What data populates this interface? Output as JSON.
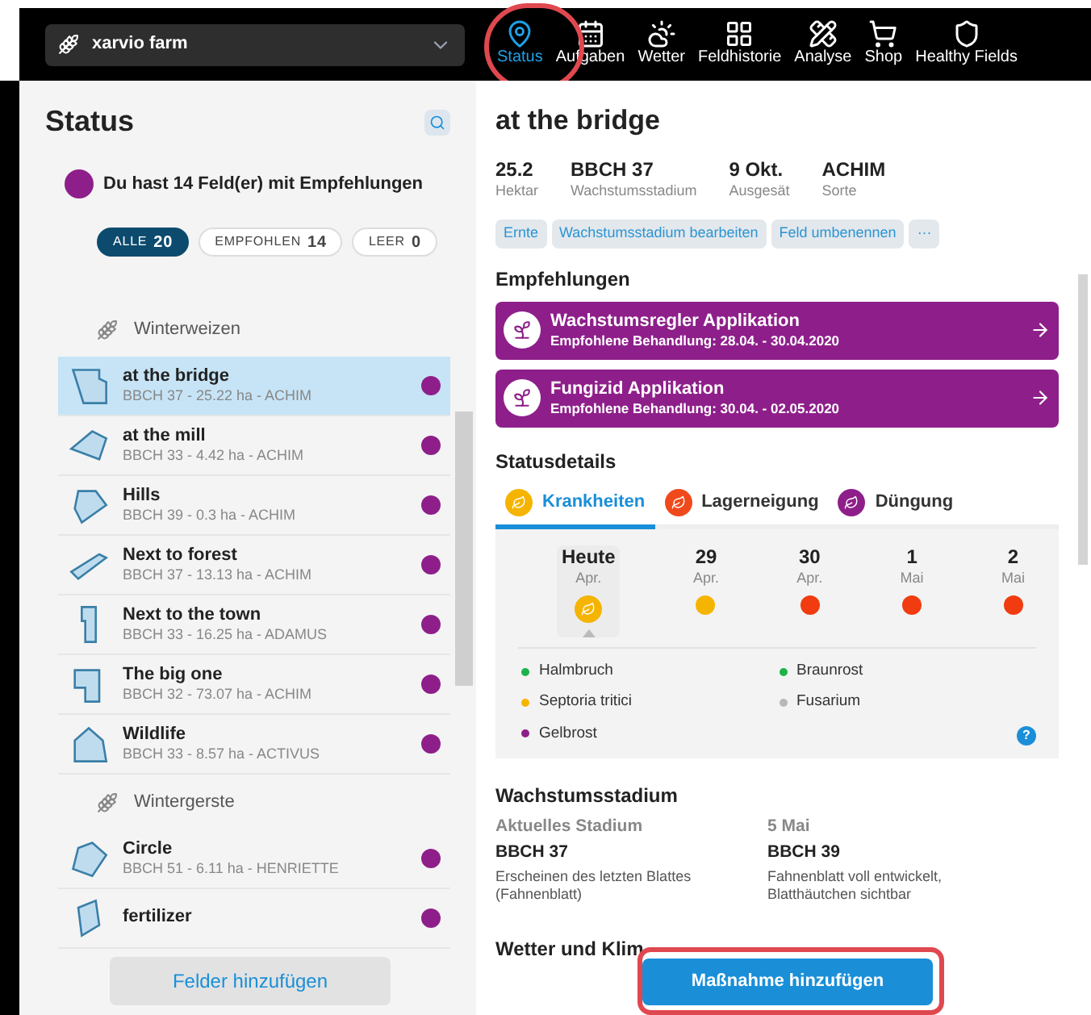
{
  "farm_selector": {
    "label": "xarvio farm"
  },
  "nav": [
    {
      "label": "Status",
      "selected": true
    },
    {
      "label": "Aufgaben",
      "selected": false
    },
    {
      "label": "Wetter",
      "selected": false
    },
    {
      "label": "Feldhistorie",
      "selected": false
    },
    {
      "label": "Analyse",
      "selected": false
    },
    {
      "label": "Shop",
      "selected": false
    },
    {
      "label": "Healthy Fields",
      "selected": false
    }
  ],
  "sidebar": {
    "title": "Status",
    "notice": "Du hast 14 Feld(er) mit Empfehlungen",
    "filters": [
      {
        "label": "ALLE",
        "count": "20",
        "selected": true
      },
      {
        "label": "EMPFOHLEN",
        "count": "14",
        "selected": false
      },
      {
        "label": "LEER",
        "count": "0",
        "selected": false
      }
    ],
    "groups": [
      {
        "crop": "Winterweizen",
        "fields": [
          {
            "name": "at the bridge",
            "meta": "BBCH 37 - 25.22 ha - ACHIM",
            "selected": true
          },
          {
            "name": "at the mill",
            "meta": "BBCH 33 - 4.42 ha - ACHIM",
            "selected": false
          },
          {
            "name": "Hills",
            "meta": "BBCH 39 - 0.3 ha - ACHIM",
            "selected": false
          },
          {
            "name": "Next to forest",
            "meta": "BBCH 37 - 13.13 ha - ACHIM",
            "selected": false
          },
          {
            "name": "Next to the town",
            "meta": "BBCH 33 - 16.25 ha - ADAMUS",
            "selected": false
          },
          {
            "name": "The big one",
            "meta": "BBCH 32 - 73.07 ha - ACHIM",
            "selected": false
          },
          {
            "name": "Wildlife",
            "meta": "BBCH 33 - 8.57 ha - ACTIVUS",
            "selected": false
          }
        ]
      },
      {
        "crop": "Wintergerste",
        "fields": [
          {
            "name": "Circle",
            "meta": "BBCH 51 - 6.11 ha - HENRIETTE",
            "selected": false
          },
          {
            "name": "fertilizer",
            "selected": false
          }
        ]
      }
    ],
    "add_button": "Felder hinzufügen"
  },
  "field": {
    "title": "at the bridge",
    "stats": [
      {
        "value": "25.2",
        "label": "Hektar"
      },
      {
        "value": "BBCH 37",
        "label": "Wachstumsstadium"
      },
      {
        "value": "9 Okt.",
        "label": "Ausgesät"
      },
      {
        "value": "ACHIM",
        "label": "Sorte"
      }
    ],
    "actions": [
      "Ernte",
      "Wachstumsstadium bearbeiten",
      "Feld umbenennen",
      "···"
    ],
    "recommendations_title": "Empfehlungen",
    "recommendations": [
      {
        "title": "Wachstumsregler Applikation",
        "subtitle": "Empfohlene Behandlung: 28.04. - 30.04.2020"
      },
      {
        "title": "Fungizid Applikation",
        "subtitle": "Empfohlene Behandlung: 30.04. - 02.05.2020"
      }
    ],
    "status_title": "Statusdetails",
    "status_tabs": [
      {
        "label": "Krankheiten",
        "color": "#f5b400",
        "selected": true
      },
      {
        "label": "Lagerneigung",
        "color": "#f04a1c",
        "selected": false
      },
      {
        "label": "Düngung",
        "color": "#8e1f8a",
        "selected": false
      }
    ],
    "days": [
      {
        "day": "Heute",
        "month": "Apr.",
        "color": "#f5b400",
        "selected": true
      },
      {
        "day": "29",
        "month": "Apr.",
        "color": "#f5b400",
        "selected": false
      },
      {
        "day": "30",
        "month": "Apr.",
        "color": "#f03c10",
        "selected": false
      },
      {
        "day": "1",
        "month": "Mai",
        "color": "#f03c10",
        "selected": false
      },
      {
        "day": "2",
        "month": "Mai",
        "color": "#f03c10",
        "selected": false
      }
    ],
    "diseases": [
      {
        "name": "Halmbruch",
        "color": "#1db34a"
      },
      {
        "name": "Braunrost",
        "color": "#1db34a"
      },
      {
        "name": "Septoria tritici",
        "color": "#f5b400"
      },
      {
        "name": "Fusarium",
        "color": "#b8b8b8"
      },
      {
        "name": "Gelbrost",
        "color": "#8e1f8a"
      }
    ],
    "help_label": "?",
    "growth_title": "Wachstumsstadium",
    "growth": [
      {
        "when": "Aktuelles Stadium",
        "stage": "BBCH 37",
        "description": "Erscheinen des letzten Blattes (Fahnenblatt)"
      },
      {
        "when": "5 Mai",
        "stage": "BBCH 39",
        "description": "Fahnenblatt voll entwickelt, Blatthäutchen sichtbar"
      }
    ],
    "weather_title": "Wetter und Klim",
    "add_action_button": "Maßnahme hinzufügen"
  }
}
